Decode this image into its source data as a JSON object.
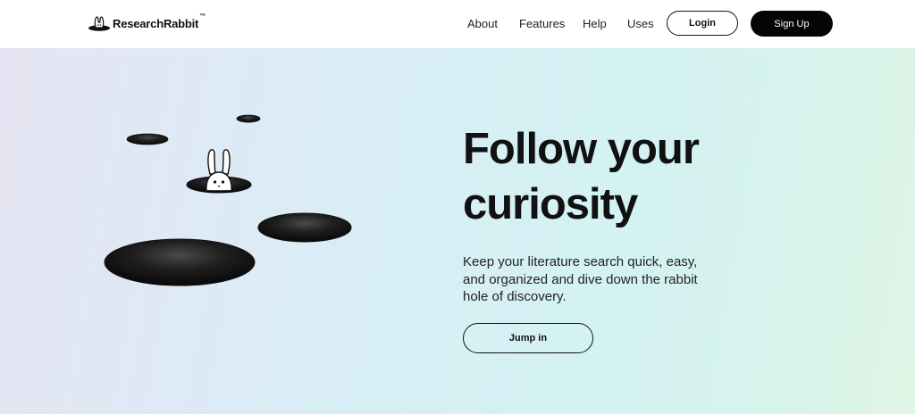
{
  "header": {
    "logo": {
      "name": "ResearchRabbit",
      "trademark": "™",
      "icon": "rabbit-in-hole-icon"
    },
    "nav": {
      "about": "About",
      "features": "Features",
      "help": "Help",
      "uses": "Uses"
    },
    "login_label": "Login",
    "signup_label": "Sign Up"
  },
  "hero": {
    "headline_line1": "Follow your",
    "headline_line2": "curiosity",
    "subtext": "Keep your literature search quick, easy, and organized and dive down the rabbit hole of discovery.",
    "cta_label": "Jump in",
    "illustration": {
      "holes": [
        "rabbit-hole-small-top",
        "rabbit-hole-small-left",
        "rabbit-hole-with-rabbit",
        "rabbit-hole-medium",
        "rabbit-hole-large"
      ],
      "rabbit": "rabbit-icon"
    }
  },
  "colors": {
    "text": "#111111",
    "signup_bg": "#050505",
    "signup_text": "#ffffff",
    "hero_gradient_start": "#e6e4f2",
    "hero_gradient_mid": "#d4f2f3",
    "hero_gradient_end": "#e0f5e4",
    "hole": "#1a1a1a"
  }
}
